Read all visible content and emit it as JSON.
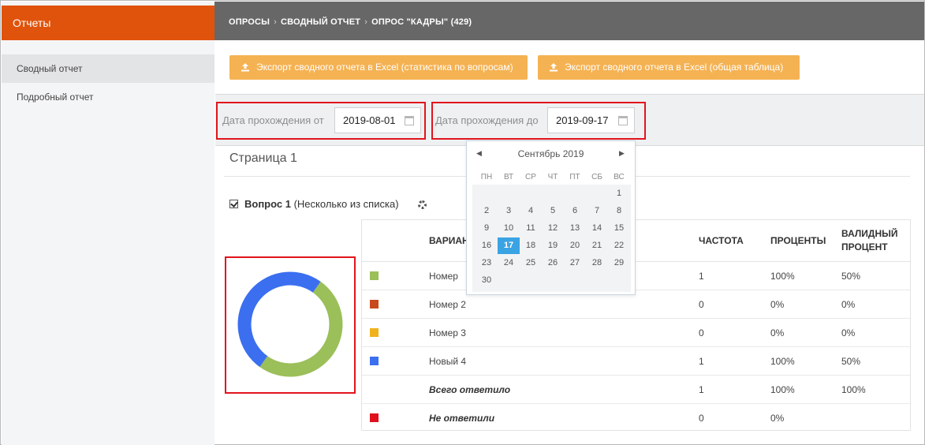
{
  "sidebar": {
    "header": "Отчеты",
    "items": [
      {
        "label": "Сводный отчет",
        "active": true
      },
      {
        "label": "Подробный отчет",
        "active": false
      }
    ]
  },
  "breadcrumb": {
    "items": [
      "ОПРОСЫ",
      "СВОДНЫЙ ОТЧЕТ",
      "ОПРОС \"КАДРЫ\" (429)"
    ]
  },
  "toolbar": {
    "export_questions": "Экспорт сводного отчета в Excel (статистика по вопросам)",
    "export_table": "Экспорт сводного отчета в Excel (общая таблица)"
  },
  "filters": {
    "from_label": "Дата прохождения от",
    "from_value": "2019-08-01",
    "to_label": "Дата прохождения до",
    "to_value": "2019-09-17"
  },
  "calendar": {
    "month": "Сентябрь 2019",
    "weekdays": [
      "ПН",
      "ВТ",
      "СР",
      "ЧТ",
      "ПТ",
      "СБ",
      "ВС"
    ],
    "first_weekday_index": 6,
    "days_in_month": 30,
    "selected_day": 17
  },
  "page": {
    "title": "Страница 1"
  },
  "question": {
    "number_label": "Вопрос 1",
    "type_label": "(Несколько из списка)"
  },
  "table": {
    "headers": {
      "variant": "ВАРИАНТ",
      "frequency": "ЧАСТОТА",
      "percent": "ПРОЦЕНТЫ",
      "valid_percent_1": "ВАЛИДНЫЙ",
      "valid_percent_2": "ПРОЦЕНТ"
    },
    "rows": [
      {
        "color": "#9bbf59",
        "label": "Номер",
        "freq": "1",
        "pct": "100%",
        "valid": "50%"
      },
      {
        "color": "#c84a1c",
        "label": "Номер 2",
        "freq": "0",
        "pct": "0%",
        "valid": "0%"
      },
      {
        "color": "#f0b21c",
        "label": "Номер 3",
        "freq": "0",
        "pct": "0%",
        "valid": "0%"
      },
      {
        "color": "#3b6ff0",
        "label": "Новый 4",
        "freq": "1",
        "pct": "100%",
        "valid": "50%"
      },
      {
        "color": "",
        "label": "Всего ответило",
        "freq": "1",
        "pct": "100%",
        "valid": "100%"
      },
      {
        "color": "#e0101c",
        "label": "Не ответили",
        "freq": "0",
        "pct": "0%",
        "valid": ""
      }
    ]
  },
  "chart_data": {
    "type": "pie",
    "categories": [
      "Номер",
      "Новый 4"
    ],
    "values": [
      1,
      1
    ],
    "colors": [
      "#9bbf59",
      "#3b6ff0"
    ]
  }
}
